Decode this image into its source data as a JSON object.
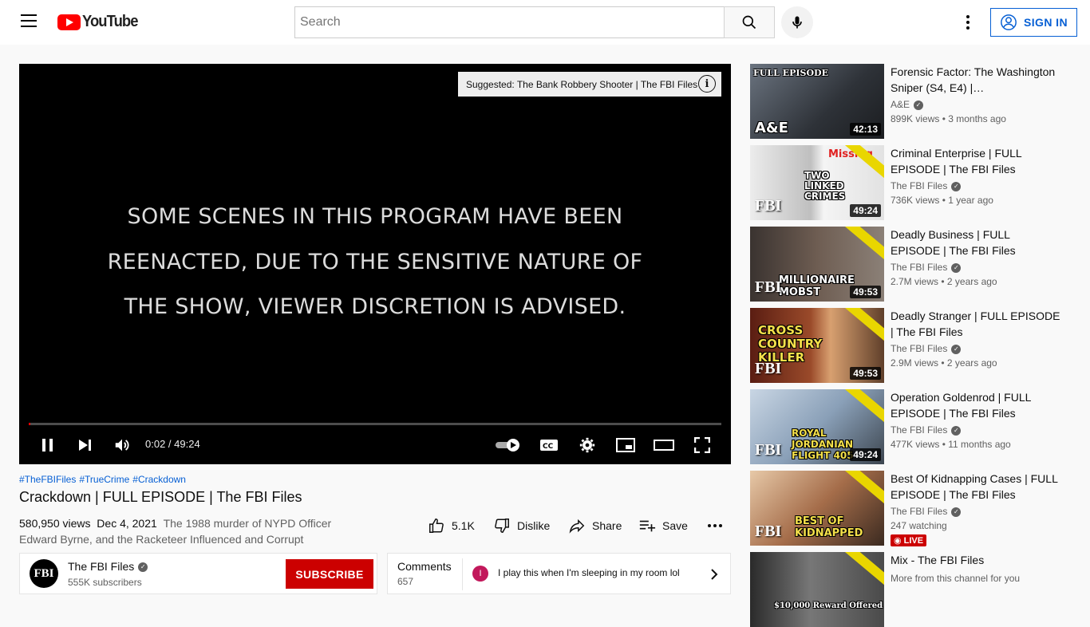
{
  "header": {
    "logo_text": "YouTube",
    "search_placeholder": "Search",
    "signin_label": "SIGN IN"
  },
  "player": {
    "overlay_lines": [
      "SOME SCENES IN THIS PROGRAM HAVE BEEN",
      "REENACTED, DUE TO THE SENSITIVE NATURE OF",
      "THE SHOW, VIEWER DISCRETION IS ADVISED."
    ],
    "suggestion": "Suggested: The Bank Robbery Shooter | The FBI Files",
    "info_glyph": "i",
    "time_display": "0:02 / 49:24",
    "progress_fraction": 0.0007
  },
  "video": {
    "hashtags": [
      "#TheFBIFiles",
      "#TrueCrime",
      "#Crackdown"
    ],
    "title": "Crackdown | FULL EPISODE | The FBI Files",
    "views": "580,950 views",
    "date": "Dec 4, 2021",
    "description_line1": "The 1988 murder of NYPD Officer",
    "description_line2": "Edward Byrne, and the Racketeer Influenced and Corrupt"
  },
  "actions": {
    "like_count": "5.1K",
    "dislike_label": "Dislike",
    "share_label": "Share",
    "save_label": "Save"
  },
  "channel": {
    "avatar_text": "FBI",
    "name": "The FBI Files",
    "subscribers": "555K subscribers",
    "subscribe_label": "SUBSCRIBE",
    "verified_glyph": "✓"
  },
  "comments": {
    "label": "Comments",
    "count": "657",
    "avatar_initial": "I",
    "top_comment": "I play this when I'm sleeping in my room lol"
  },
  "recommendations": [
    {
      "title": "Forensic Factor: The Washington Sniper (S4, E4) |…",
      "channel": "A&E",
      "verified": true,
      "views": "899K views • 3 months ago",
      "duration": "42:13",
      "thumb_color": "#4a5560",
      "thumb_label": "FULL EPISODE",
      "brand": "A&E"
    },
    {
      "title": "Criminal Enterprise | FULL EPISODE | The FBI Files",
      "channel": "The FBI Files",
      "verified": true,
      "views": "736K views • 1 year ago",
      "duration": "49:24",
      "thumb_color": "#d9d9d9",
      "caption": "TWO LINKED CRIMES",
      "badge_text": "Missing",
      "fbi": "FBI"
    },
    {
      "title": "Deadly Business | FULL EPISODE | The FBI Files",
      "channel": "The FBI Files",
      "verified": true,
      "views": "2.7M views • 2 years ago",
      "duration": "49:53",
      "thumb_color": "#5a4d44",
      "caption": "MILLIONAIRE MOBST",
      "fbi": "FBI"
    },
    {
      "title": "Deadly Stranger | FULL EPISODE | The FBI Files",
      "channel": "The FBI Files",
      "verified": true,
      "views": "2.9M views • 2 years ago",
      "duration": "49:53",
      "thumb_color": "#7a3a25",
      "caption": "CROSS COUNTRY KILLER",
      "fbi": "FBI"
    },
    {
      "title": "Operation Goldenrod | FULL EPISODE | The FBI Files",
      "channel": "The FBI Files",
      "verified": true,
      "views": "477K views • 11 months ago",
      "duration": "49:24",
      "thumb_color": "#8aa0b8",
      "caption": "ROYAL JORDANIAN FLIGHT 405",
      "fbi": "FBI"
    },
    {
      "title": "Best Of Kidnapping Cases | FULL EPISODE | The FBI Files",
      "channel": "The FBI Files",
      "verified": true,
      "views": "247 watching",
      "live": "LIVE",
      "thumb_color": "#a56d4a",
      "caption": "BEST OF KIDNAPPED",
      "fbi": "FBI"
    },
    {
      "title": "Mix - The FBI Files",
      "channel": "More from this channel for you",
      "verified": false,
      "views": "",
      "thumb_color": "#666",
      "caption": "$10,000 Reward Offered"
    }
  ]
}
